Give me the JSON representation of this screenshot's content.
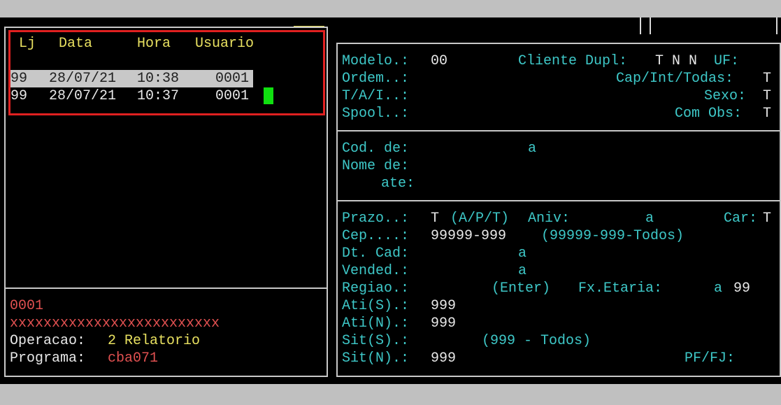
{
  "history": {
    "headers": {
      "lj": "Lj",
      "data": "Data",
      "hora": "Hora",
      "usuario": "Usuario"
    },
    "rows": [
      {
        "lj": "99",
        "data": "28/07/21",
        "hora": "10:38",
        "usuario": "0001",
        "selected": true
      },
      {
        "lj": "99",
        "data": "28/07/21",
        "hora": "10:37",
        "usuario": "0001",
        "selected": false
      }
    ]
  },
  "status": {
    "user_code": "0001",
    "user_name": "xxxxxxxxxxxxxxxxxxxxxxxxx",
    "operacao_label": "Operacao:",
    "operacao_value": "2 Relatorio",
    "programa_label": "Programa:",
    "programa_value": "cba071"
  },
  "form_top": {
    "modelo_label": "Modelo.:",
    "modelo_value": "00",
    "cliente_dupl_label": "Cliente Dupl:",
    "cliente_dupl_value": "T N N",
    "uf_label": "UF:",
    "ordem_label": "Ordem..:",
    "cap_int_label": "Cap/Int/Todas:",
    "cap_int_value": "T",
    "tai_label": "T/A/I..:",
    "sexo_label": "Sexo:",
    "sexo_value": "T",
    "spool_label": "Spool..:",
    "com_obs_label": "Com Obs:",
    "com_obs_value": "T"
  },
  "form_mid": {
    "cod_label": "Cod. de:",
    "cod_a": "a",
    "nome_label": "Nome de:",
    "ate_label": "ate:"
  },
  "form_bottom": {
    "prazo_label": "Prazo..:",
    "prazo_value": "T",
    "prazo_hint": "(A/P/T)",
    "aniv_label": "Aniv:",
    "aniv_a": "a",
    "car_label": "Car:",
    "car_value": "T",
    "cep_label": "Cep....:",
    "cep_value": "99999-999",
    "cep_hint": "(99999-999-Todos)",
    "dtcad_label": "Dt. Cad:",
    "dtcad_a": "a",
    "vended_label": "Vended.:",
    "vended_a": "a",
    "regiao_label": "Regiao.:",
    "regiao_hint": "(Enter)",
    "fx_label": "Fx.Etaria:",
    "fx_a": "a",
    "fx_value": "99",
    "atis_label": "Ati(S).:",
    "atis_value": "999",
    "atin_label": "Ati(N).:",
    "atin_value": "999",
    "sits_label": "Sit(S).:",
    "sits_hint": "(999 - Todos)",
    "sitn_label": "Sit(N).:",
    "sitn_value": "999",
    "pffj_label": "PF/FJ:"
  }
}
